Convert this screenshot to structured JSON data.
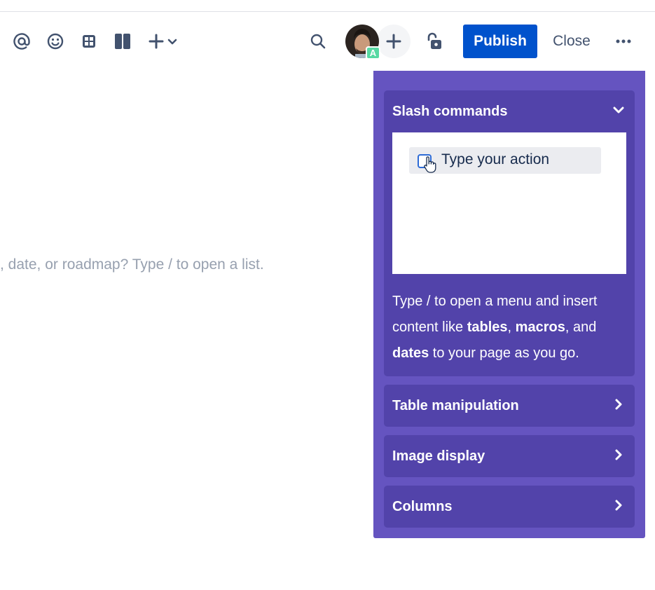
{
  "toolbar": {
    "icons": [
      "mention-icon",
      "emoji-icon",
      "table-icon",
      "layout-icon",
      "insert-icon",
      "dropdown-chevron-icon"
    ],
    "search_icon": "search-icon",
    "avatar_badge": "A",
    "add_collaborator_icon": "plus-icon",
    "restrictions_icon": "unlock-icon",
    "publish_label": "Publish",
    "close_label": "Close",
    "more_icon": "more-icon",
    "publish_color": "#0052CC"
  },
  "editor": {
    "placeholder_fragment": ", date, or roadmap? Type / to open a list."
  },
  "help_panel": {
    "background": "#6554C0",
    "section_background": "#5243AA",
    "sections": [
      {
        "title": "Slash commands",
        "expanded": true,
        "preview_text": "Type your action",
        "description": {
          "part1": "Type / to open a menu and insert content like ",
          "bold1": "tables",
          "part2": ", ",
          "bold2": "macros",
          "part3": ", and ",
          "bold3": "dates",
          "part4": " to your page as you go."
        }
      },
      {
        "title": "Table manipulation",
        "expanded": false
      },
      {
        "title": "Image display",
        "expanded": false
      },
      {
        "title": "Columns",
        "expanded": false
      }
    ]
  }
}
